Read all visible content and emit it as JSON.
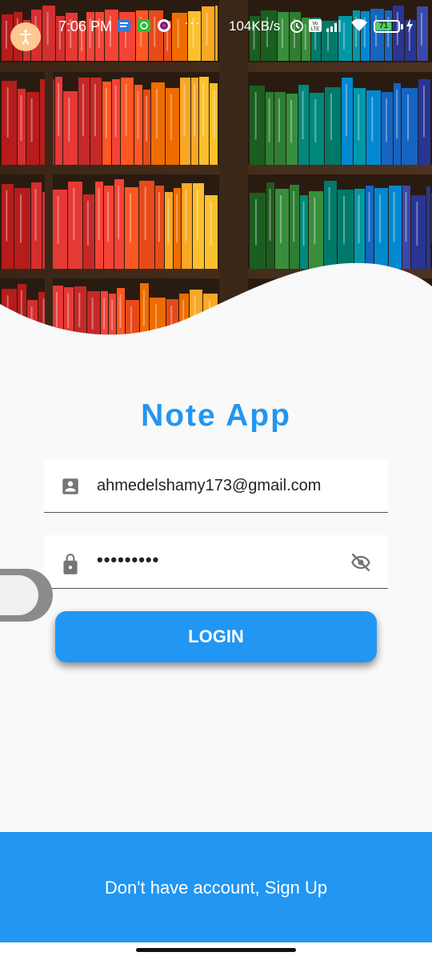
{
  "status_bar": {
    "time": "7:06 PM",
    "more": "···",
    "network_speed": "104KB/s",
    "battery_level": "71",
    "battery_percent": 71,
    "icons": [
      "message-icon",
      "wechat-icon",
      "record-icon",
      "alarm-icon",
      "volte-icon",
      "signal-icon",
      "wifi-icon",
      "battery-icon",
      "charging-icon"
    ]
  },
  "hero": {
    "image": "bookshelf-photo"
  },
  "title": "Note App",
  "email": {
    "value": "ahmedelshamy173@gmail.com",
    "icon": "account-box-icon"
  },
  "password": {
    "value": "•••••••••",
    "icon": "lock-icon",
    "toggle_icon": "visibility-off-icon"
  },
  "login_button": "LOGIN",
  "signup_link": "Don't have account, Sign Up",
  "accessibility_icon": "accessibility-icon",
  "colors": {
    "primary": "#2196f3",
    "background": "#f9f9f9",
    "button_text": "#ffffff"
  }
}
